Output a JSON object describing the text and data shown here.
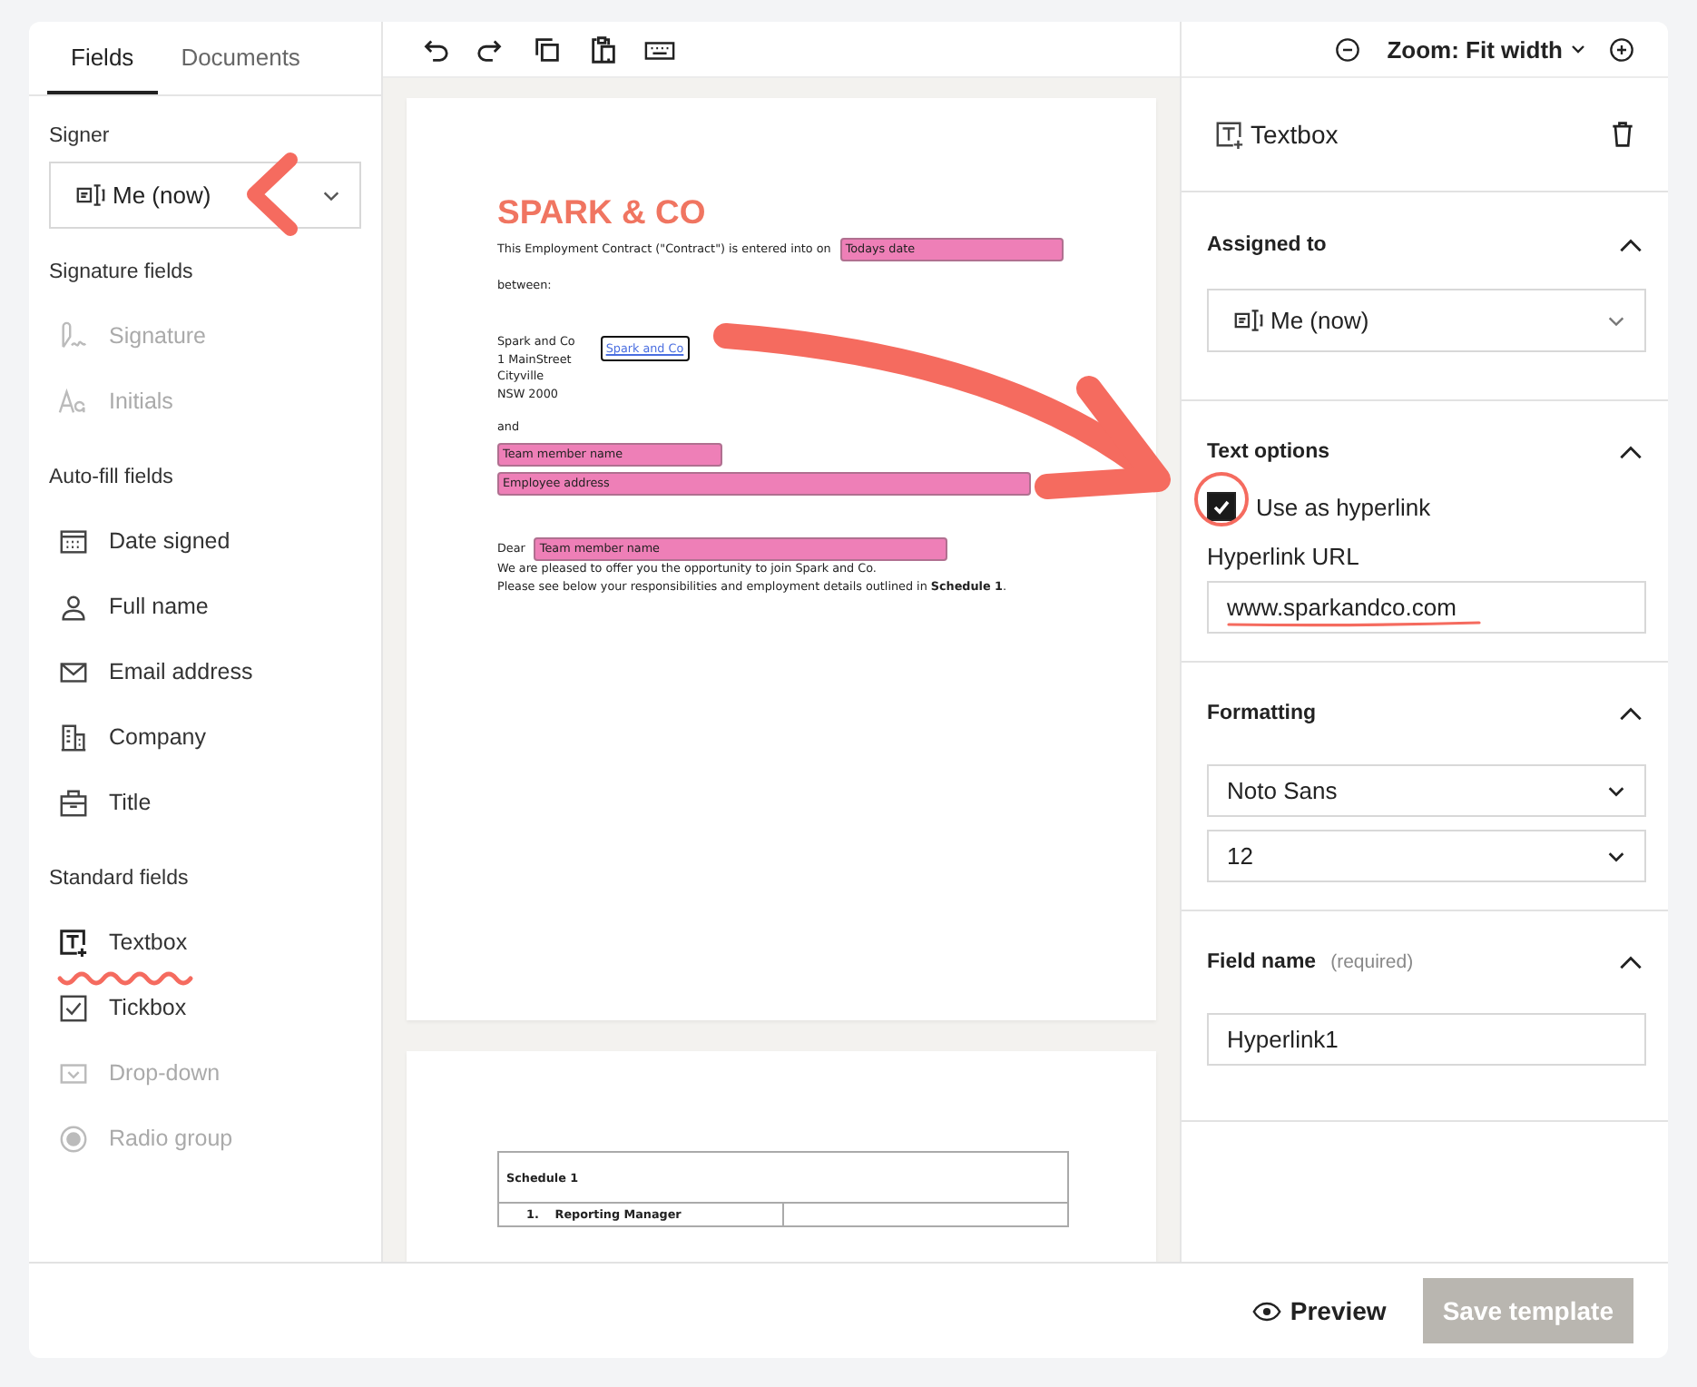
{
  "sidebar": {
    "tabs": [
      {
        "label": "Fields",
        "selected": true
      },
      {
        "label": "Documents",
        "selected": false
      }
    ],
    "signer": {
      "label": "Signer",
      "value": "Me (now)"
    },
    "sections": [
      {
        "title": "Signature fields",
        "items": [
          {
            "label": "Signature",
            "disabled": true
          },
          {
            "label": "Initials",
            "disabled": true
          }
        ]
      },
      {
        "title": "Auto-fill fields",
        "items": [
          {
            "label": "Date signed",
            "disabled": false
          },
          {
            "label": "Full name",
            "disabled": false
          },
          {
            "label": "Email address",
            "disabled": false
          },
          {
            "label": "Company",
            "disabled": false
          },
          {
            "label": "Title",
            "disabled": false
          }
        ]
      },
      {
        "title": "Standard fields",
        "items": [
          {
            "label": "Textbox",
            "disabled": false
          },
          {
            "label": "Tickbox",
            "disabled": false
          },
          {
            "label": "Drop-down",
            "disabled": true
          },
          {
            "label": "Radio group",
            "disabled": true
          }
        ]
      }
    ]
  },
  "toolbar": {
    "zoom": "Zoom: Fit width"
  },
  "document": {
    "page1": [
      {
        "kind": "title",
        "text": "SPARK & CO"
      },
      {
        "kind": "text_field",
        "text": "This Employment Contract (\"Contract\") is entered into on",
        "field": "Todays date"
      },
      {
        "kind": "text",
        "text": "between:"
      },
      {
        "kind": "address",
        "lines": [
          "Spark and Co",
          "1 MainStreet",
          "Cityville",
          "NSW 2000"
        ],
        "link": "Spark and Co",
        "selected": true
      },
      {
        "kind": "text",
        "text": "and"
      },
      {
        "kind": "field",
        "text": "Team member name"
      },
      {
        "kind": "field_wide",
        "text": "Employee address"
      },
      {
        "kind": "text_field",
        "text": "Dear",
        "field": "Team member name"
      },
      {
        "kind": "text",
        "text": "We are pleased to offer you the opportunity to join Spark and Co."
      },
      {
        "kind": "text",
        "text": "Please see below your responsibilities and employment details outlined in **Schedule 1**."
      }
    ],
    "page2": {
      "table_title": "Schedule 1",
      "row": [
        "1.",
        "Reporting Manager"
      ]
    }
  },
  "panel": {
    "title": "Textbox",
    "sections": [
      {
        "kind": "assigned",
        "title": "Assigned to",
        "expanded": true,
        "select": "Me (now)"
      },
      {
        "kind": "text_options",
        "title": "Text options",
        "expanded": true,
        "checkbox": {
          "label": "Use as hyperlink",
          "checked": true
        },
        "url_label": "Hyperlink URL",
        "url": "www.sparkandco.com"
      },
      {
        "kind": "formatting",
        "title": "Formatting",
        "expanded": true,
        "font": "Noto Sans",
        "size": "12"
      },
      {
        "kind": "field_name",
        "title": "Field name",
        "hint": "(required)",
        "expanded": true,
        "value": "Hyperlink1"
      }
    ]
  },
  "footer": {
    "preview": "Preview",
    "save": {
      "label": "Save template",
      "disabled": true
    }
  }
}
